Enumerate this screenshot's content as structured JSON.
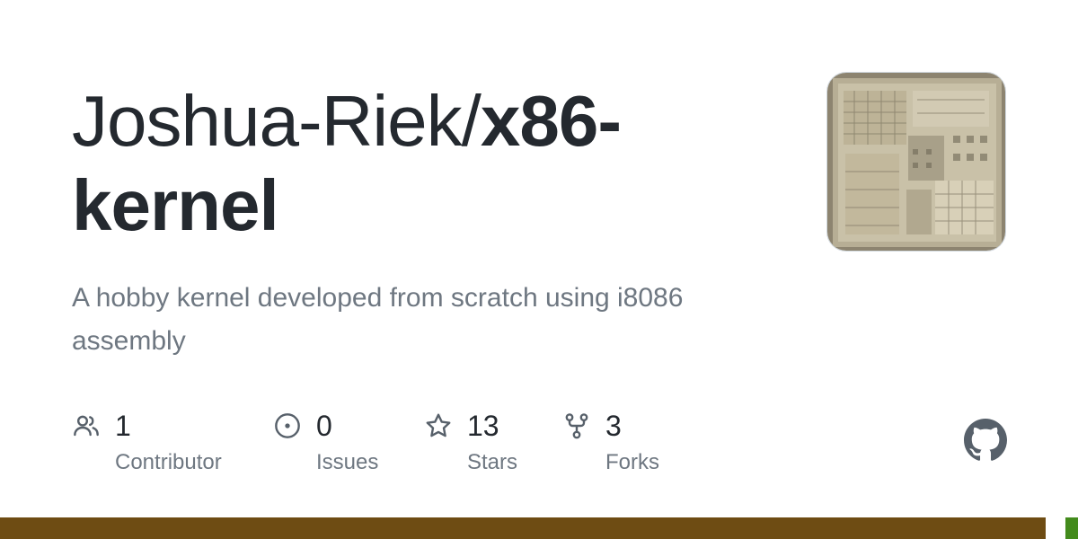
{
  "card": {
    "owner": "Joshua-Riek/",
    "repo_line1": "x86-",
    "repo_line2": "kernel",
    "description": "A hobby kernel developed from scratch using i8086 assembly"
  },
  "stats": [
    {
      "icon": "people-icon",
      "count": "1",
      "label": "Contributor"
    },
    {
      "icon": "issue-opened-icon",
      "count": "0",
      "label": "Issues"
    },
    {
      "icon": "star-icon",
      "count": "13",
      "label": "Stars"
    },
    {
      "icon": "repo-forked-icon",
      "count": "3",
      "label": "Forks"
    }
  ],
  "logo": {
    "icon": "github-mark-icon"
  },
  "language_bar": {
    "segments": [
      {
        "color": "#6e4c13",
        "share": 0.97
      },
      {
        "color": "#438b1c",
        "share": 0.01
      }
    ]
  },
  "colors": {
    "title": "#24292f",
    "muted": "#6e7781",
    "icon": "#57606a"
  }
}
